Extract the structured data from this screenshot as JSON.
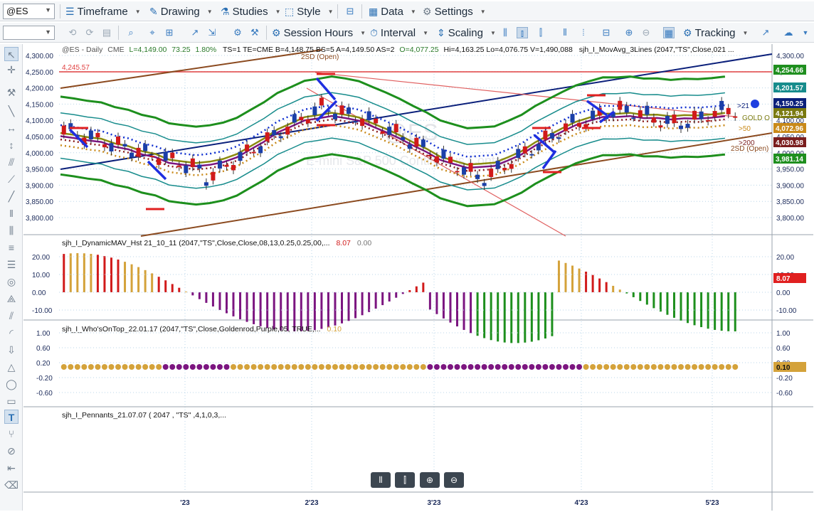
{
  "toolbar1": {
    "symbol": "@ES",
    "timeframe": "Timeframe",
    "drawing": "Drawing",
    "studies": "Studies",
    "style": "Style",
    "data": "Data",
    "settings": "Settings"
  },
  "toolbar2": {
    "session_hours": "Session Hours",
    "interval": "Interval",
    "scaling": "Scaling",
    "tracking": "Tracking"
  },
  "chart": {
    "header": {
      "symbol_label": "@ES - Daily",
      "exchange": "CME",
      "last": "L=4,149.00",
      "change": "73.25",
      "change_pct": "1.80%",
      "info": "TS=1  TE=CME  B=4,148.75  BS=5  A=4,149.50  AS=2",
      "open": "O=4,077.25",
      "hilo": "Hi=4,163.25  Lo=4,076.75  V=1,490,088",
      "study": "sjh_I_MovAvg_3Lines (2047,\"TS\",Close,021 ..."
    },
    "watermark": "@ES",
    "watermark_sub": "E-mini S&P 500 Continuous Contract",
    "hline_label": "4,245.57",
    "sd_top_label": "2SD (Open)",
    "sd_bottom_label": "2SD (Open)",
    "ma_labels": [
      ">21",
      "GOLD O",
      ">50",
      ">200"
    ],
    "price_ticks": [
      "4,300.00",
      "4,250.00",
      "4,200.00",
      "4,150.00",
      "4,100.00",
      "4,050.00",
      "4,000.00",
      "3,950.00",
      "3,900.00",
      "3,850.00",
      "3,800.00"
    ],
    "price_tags": [
      {
        "value": "4,254.66",
        "color": "#1f8f1f"
      },
      {
        "value": "4,201.57",
        "color": "#178c8c"
      },
      {
        "value": "4,150.25",
        "color": "#0a1f7a"
      },
      {
        "value": "4,121.94",
        "color": "#7a7a10"
      },
      {
        "value": "4,072.96",
        "color": "#c98a1a"
      },
      {
        "value": "4,030.98",
        "color": "#7a1d1d"
      },
      {
        "value": "3,981.14",
        "color": "#1f8f1f"
      }
    ],
    "dates": [
      "'23",
      "2'23",
      "3'23",
      "4'23",
      "5'23"
    ]
  },
  "panel1": {
    "title": "sjh_I_DynamicMAV_Hst 21_10_11 (2047,\"TS\",Close,Close,08,13,0.25,0.25,00,...",
    "value1": "8.07",
    "value2": "0.00",
    "ticks": [
      "20.00",
      "10.00",
      "0.00",
      "-10.00"
    ],
    "tag": "8.07"
  },
  "panel2": {
    "title": "sjh_I_Who'sOnTop_22.01.17 (2047,\"TS\",Close,Goldenrod,Purple,05, TRUE,...",
    "value": "0.10",
    "ticks": [
      "1.00",
      "0.60",
      "0.20",
      "-0.20",
      "-0.60"
    ],
    "tag": "0.10"
  },
  "panel3": {
    "title": "sjh_I_Pennants_21.07.07 ( 2047 , \"TS\" ,4,1,0,3,..."
  },
  "colors": {
    "up": "#1b3fa8",
    "down": "#d11a1a",
    "green": "#1d8f1d",
    "teal": "#178c8c",
    "navy": "#0a1f7a",
    "brown": "#8b4a1f",
    "gold": "#d4a23a",
    "purple": "#7b1580"
  }
}
